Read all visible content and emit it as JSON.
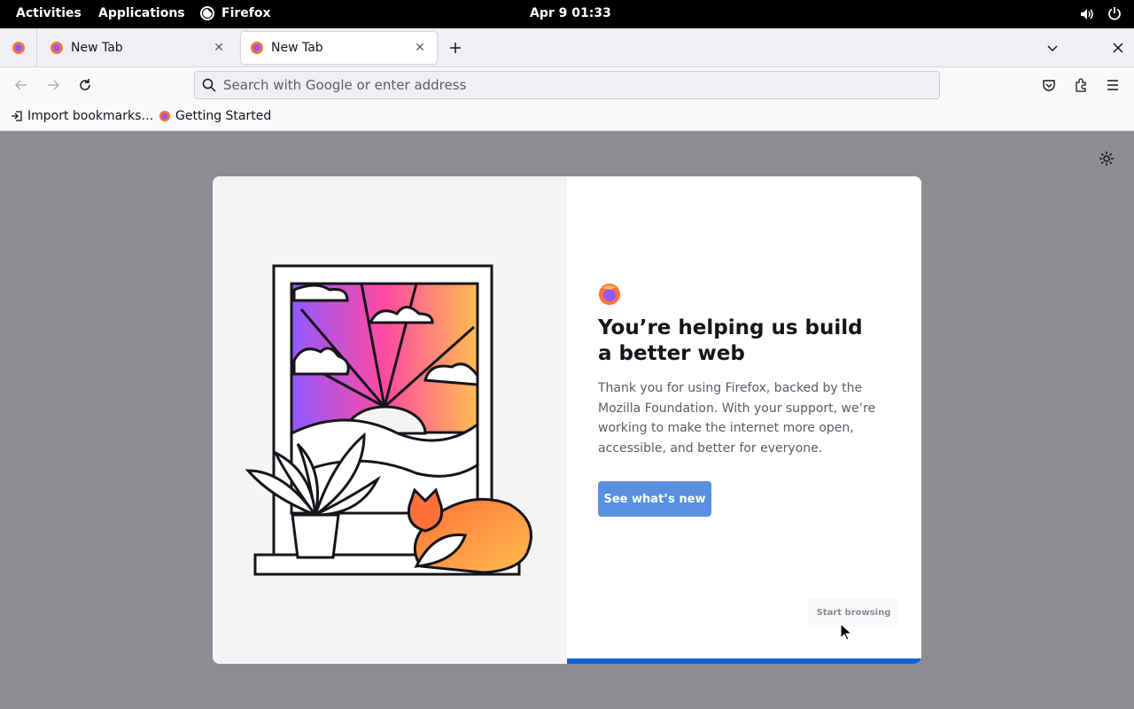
{
  "topbar": {
    "activities": "Activities",
    "applications": "Applications",
    "app_name": "Firefox",
    "clock": "Apr 9  01:33"
  },
  "tabs": [
    {
      "label": "New Tab",
      "active": false
    },
    {
      "label": "New Tab",
      "active": true
    }
  ],
  "urlbar": {
    "placeholder": "Search with Google or enter address",
    "value": ""
  },
  "bookmarks": [
    {
      "label": "Import bookmarks…",
      "icon": "import-icon"
    },
    {
      "label": "Getting Started",
      "icon": "firefox-icon"
    }
  ],
  "onboarding": {
    "headline": "You’re helping us build a better web",
    "body": "Thank you for using Firefox, backed by the Mozilla Foundation. With your support, we’re working to make the internet more open, accessible, and better for everyone.",
    "primary_button": "See what’s new",
    "secondary_button": "Start browsing",
    "progress_fraction": 1.0
  },
  "colors": {
    "accent": "#0a64d6",
    "primary_button": "#5890e2",
    "backdrop": "#8e8d94"
  }
}
